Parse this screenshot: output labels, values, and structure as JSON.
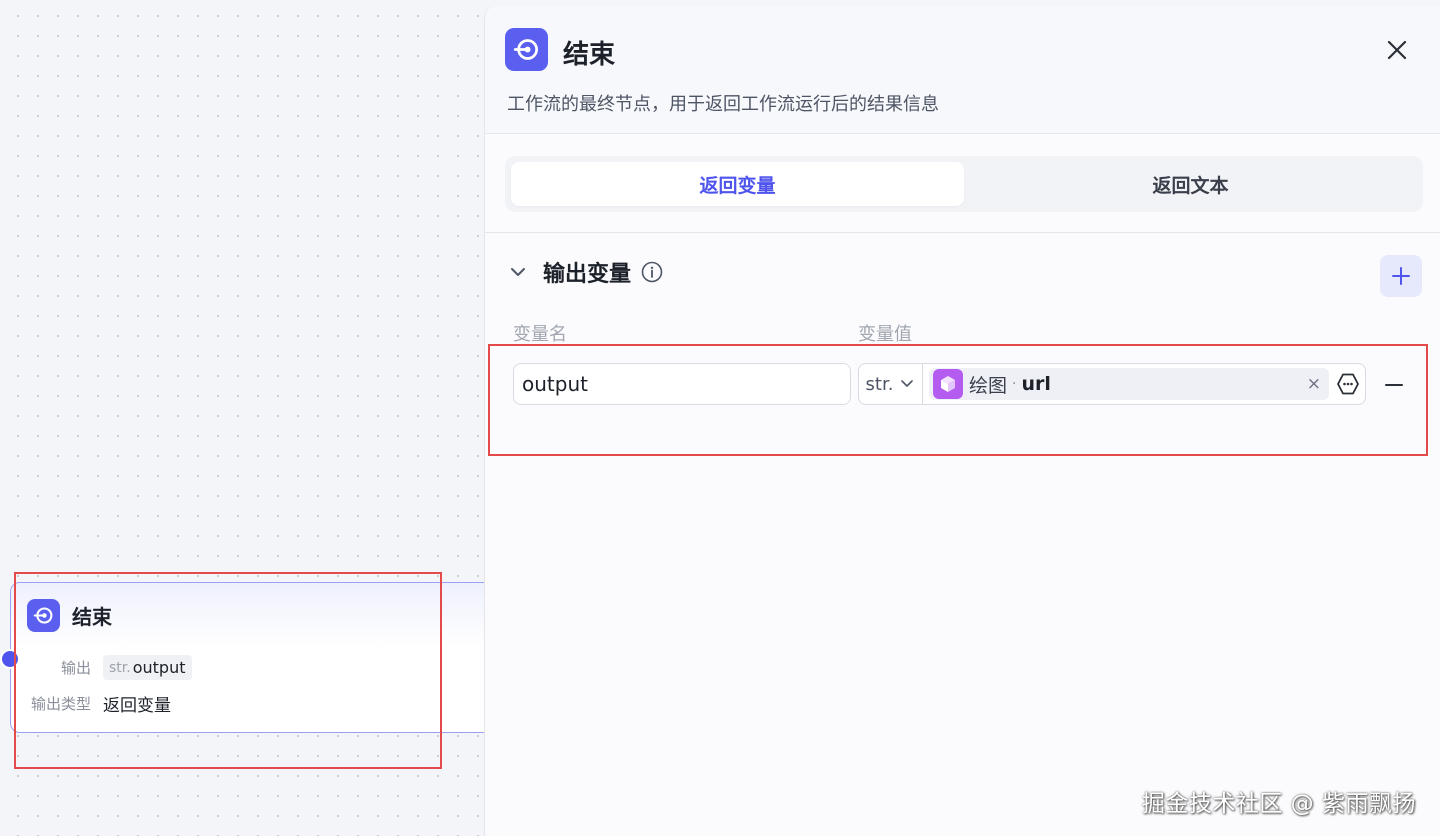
{
  "node": {
    "title": "结束",
    "output_label": "输出",
    "output_type": "str.",
    "output_name": "output",
    "output_kind_label": "输出类型",
    "output_kind_value": "返回变量"
  },
  "panel": {
    "title": "结束",
    "description": "工作流的最终节点，用于返回工作流运行后的结果信息",
    "tabs": [
      "返回变量",
      "返回文本"
    ],
    "section_title": "输出变量",
    "col_name": "变量名",
    "col_value": "变量值",
    "row": {
      "name": "output",
      "type": "str.",
      "ref_source": "绘图",
      "ref_sep": "·",
      "ref_var": "url",
      "clear": "×"
    }
  },
  "watermark": "掘金技术社区 @ 紫雨飘扬",
  "colors": {
    "accent": "#4f55ec",
    "node_icon": "#5b5ff0",
    "ref_icon": "#b45cf0",
    "highlight": "#e54a4a"
  },
  "icons": {
    "node": "end-node-icon",
    "close": "close-icon",
    "chevron": "chevron-down-icon",
    "info": "info-icon",
    "add": "plus-icon",
    "ref": "cube-icon",
    "variable": "variable-icon",
    "remove": "minus-icon"
  }
}
